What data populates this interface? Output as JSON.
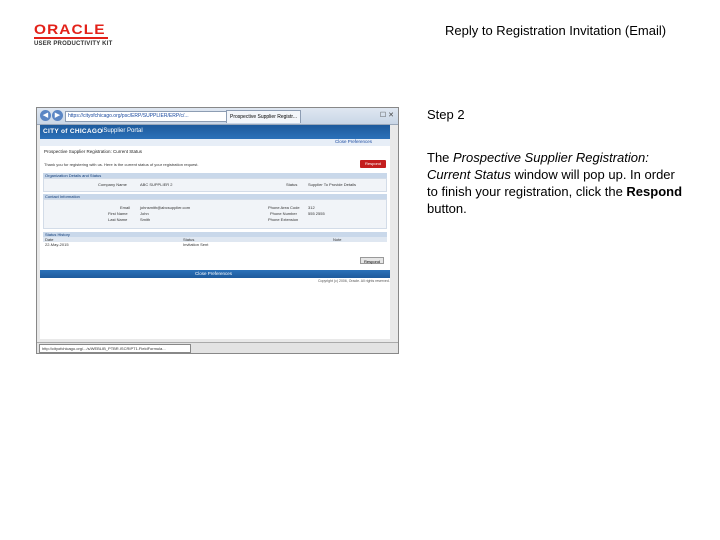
{
  "logo": {
    "brand": "ORACLE",
    "product": "USER PRODUCTIVITY KIT"
  },
  "slide_title": "Reply to Registration Invitation (Email)",
  "step": {
    "label": "Step 2",
    "desc_1": "The ",
    "desc_em": "Prospective Supplier Registration: Current Status",
    "desc_2": " window will pop up. In order to finish your registration, click the ",
    "desc_bold": "Respond",
    "desc_3": " button."
  },
  "browser": {
    "url": "https://cityofchicago.org/psc/ERP/SUPPLIER/ERP/c/...",
    "tab_title": "Prospective Supplier Registr...",
    "status_text": "http://cityofchicago.org/.../s/WEBLIB_PTBR.ISCRIPT1.FieldFormula..."
  },
  "portal": {
    "city_logo": "CITY of CHICAGO",
    "title": "iSupplier Portal",
    "links": "Close   Preferences",
    "heading": "Prospective Supplier Registration: Current Status",
    "info": "Thank you for registering with us. Here is the current status of your registration request.",
    "respond_label": "Respond",
    "section_org": "Organization Details and Status",
    "company_label": "Company Name",
    "company_value": "ABC SUPPLIER 2",
    "status_label": "Status",
    "status_value": "Supplier To Provide Details",
    "section_contact": "Contact Information",
    "email_label": "Email",
    "email_value": "johnsmith@abcsupplier.com",
    "first_label": "First Name",
    "first_value": "John",
    "last_label": "Last Name",
    "last_value": "Smith",
    "area_label": "Phone Area Code",
    "area_value": "312",
    "phone_label": "Phone Number",
    "phone_value": "555 2555",
    "ext_label": "Phone Extension",
    "ext_value": "",
    "section_history": "Status History",
    "col_date": "Date",
    "col_status": "Status",
    "col_note": "Note",
    "row_date": "22-May-2015",
    "row_status": "Invitation Sent",
    "row_note": "",
    "respond_small": "Respond",
    "footer_links": "Close   Preferences",
    "copyright": "Copyright (c) 2006, Oracle. All rights reserved."
  }
}
